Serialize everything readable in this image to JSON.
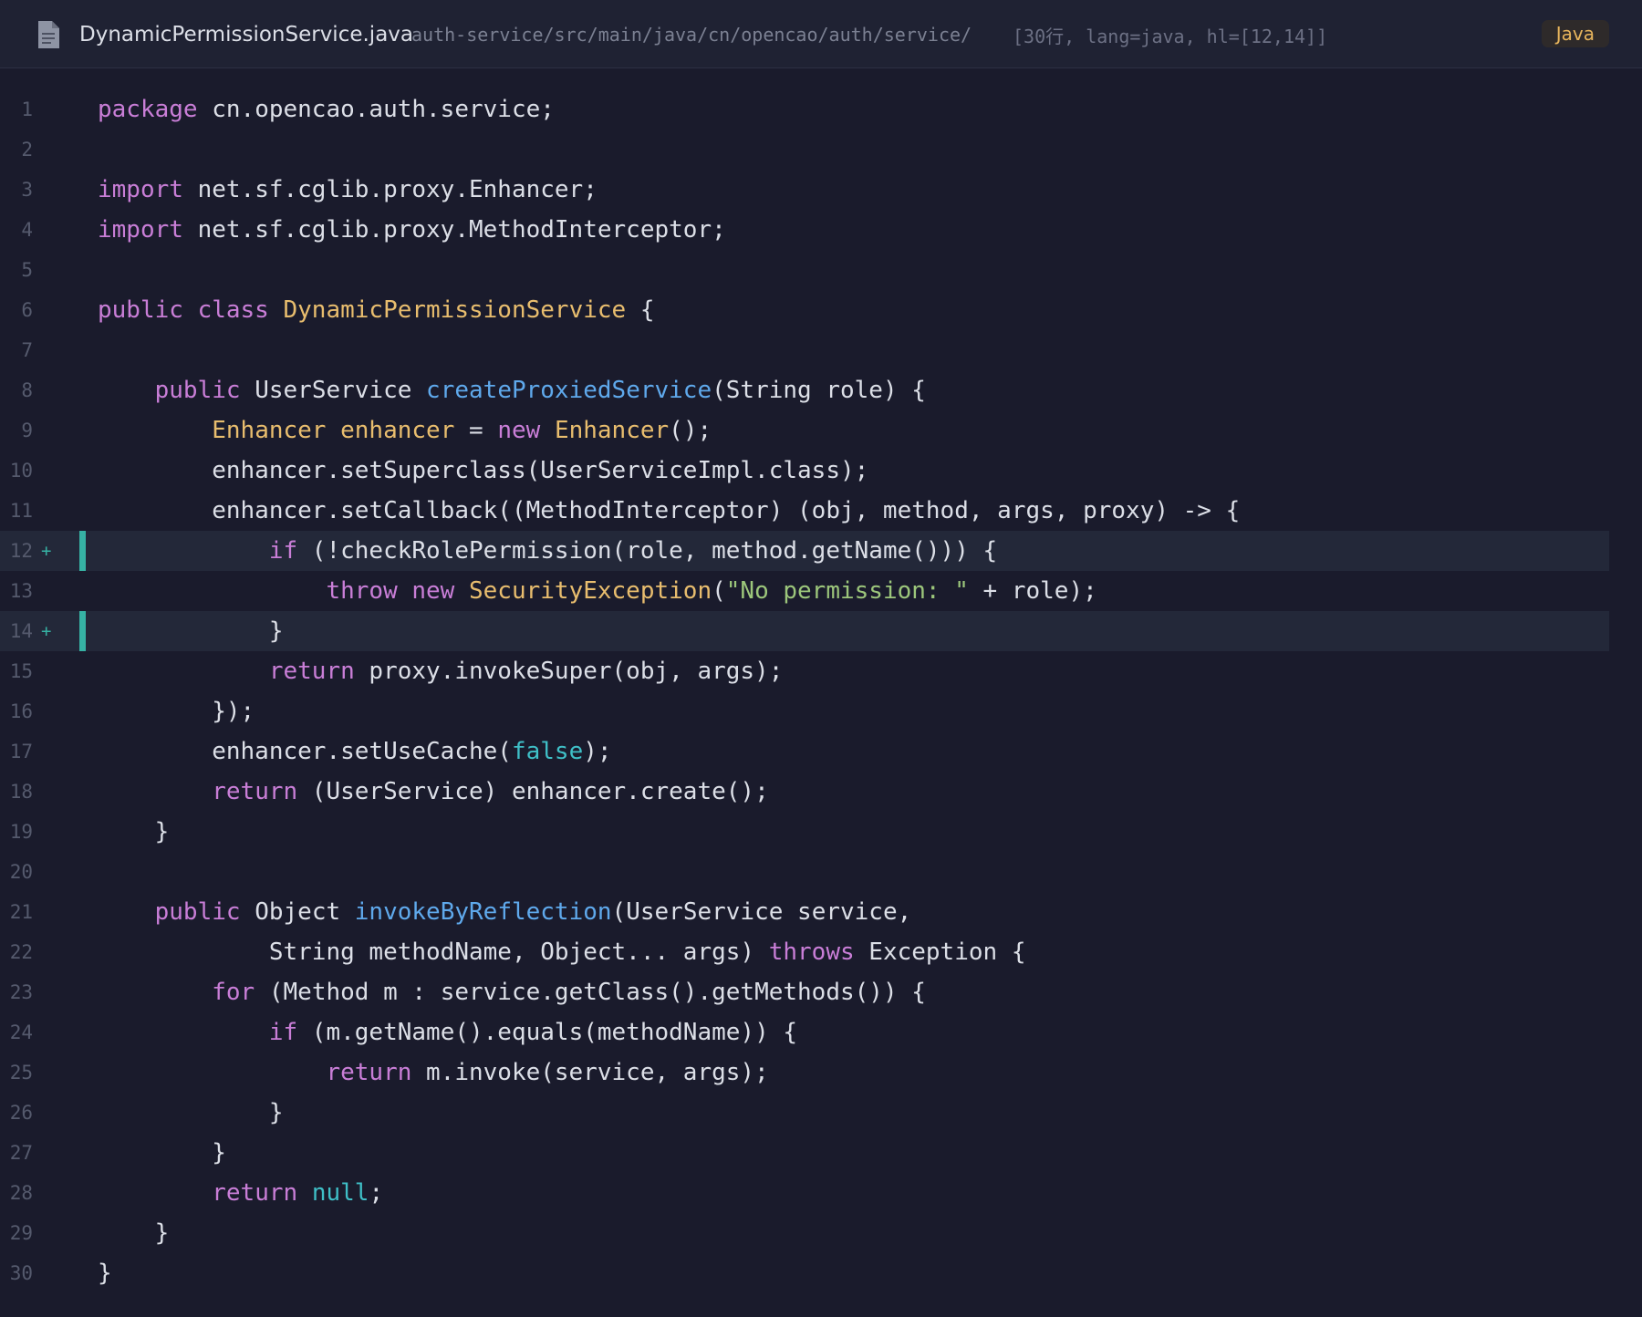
{
  "header": {
    "filename": "DynamicPermissionService.java",
    "path": "auth-service/src/main/java/cn/opencao/auth/service/",
    "meta": "[30行, lang=java, hl=[12,14]]",
    "language": "Java",
    "icon": "file-icon"
  },
  "colors": {
    "background": "#1a1b2c",
    "keyword": "#c97ed7",
    "type": "#e8bd6e",
    "function": "#5fa9ec",
    "string": "#9cc67b",
    "literal": "#3fbfc7",
    "highlight_bar": "#36b2a4"
  },
  "code": {
    "lines": [
      {
        "n": "1",
        "t": [
          [
            "kw",
            "package"
          ],
          [
            "p",
            " cn.opencao.auth.service;"
          ]
        ]
      },
      {
        "n": "2",
        "t": []
      },
      {
        "n": "3",
        "t": [
          [
            "kw",
            "import"
          ],
          [
            "p",
            " net.sf.cglib.proxy.Enhancer;"
          ]
        ]
      },
      {
        "n": "4",
        "t": [
          [
            "kw",
            "import"
          ],
          [
            "p",
            " net.sf.cglib.proxy.MethodInterceptor;"
          ]
        ]
      },
      {
        "n": "5",
        "t": []
      },
      {
        "n": "6",
        "t": [
          [
            "kw",
            "public class "
          ],
          [
            "type",
            "DynamicPermissionService"
          ],
          [
            "p",
            " {"
          ]
        ]
      },
      {
        "n": "7",
        "t": []
      },
      {
        "n": "8",
        "t": [
          [
            "p",
            "    "
          ],
          [
            "kw",
            "public"
          ],
          [
            "p",
            " UserService "
          ],
          [
            "fn",
            "createProxiedService"
          ],
          [
            "p",
            "(String role) {"
          ]
        ]
      },
      {
        "n": "9",
        "t": [
          [
            "p",
            "        "
          ],
          [
            "type",
            "Enhancer enhancer"
          ],
          [
            "p",
            " = "
          ],
          [
            "kw",
            "new "
          ],
          [
            "type",
            "Enhancer"
          ],
          [
            "p",
            "();"
          ]
        ]
      },
      {
        "n": "10",
        "t": [
          [
            "p",
            "        enhancer.setSuperclass(UserServiceImpl.class);"
          ]
        ]
      },
      {
        "n": "11",
        "t": [
          [
            "p",
            "        enhancer.setCallback((MethodInterceptor) (obj, method, args, proxy) -> {"
          ]
        ]
      },
      {
        "n": "12",
        "hl": true,
        "marker": "+",
        "t": [
          [
            "p",
            "            "
          ],
          [
            "kw",
            "if"
          ],
          [
            "p",
            " (!checkRolePermission(role, method.getName())) {"
          ]
        ]
      },
      {
        "n": "13",
        "t": [
          [
            "p",
            "                "
          ],
          [
            "kw",
            "throw new "
          ],
          [
            "type",
            "SecurityException"
          ],
          [
            "p",
            "("
          ],
          [
            "str",
            "\"No permission: \""
          ],
          [
            "p",
            " + role);"
          ]
        ]
      },
      {
        "n": "14",
        "hl": true,
        "marker": "+",
        "t": [
          [
            "p",
            "            }"
          ]
        ]
      },
      {
        "n": "15",
        "t": [
          [
            "p",
            "            "
          ],
          [
            "kw",
            "return"
          ],
          [
            "p",
            " proxy.invokeSuper(obj, args);"
          ]
        ]
      },
      {
        "n": "16",
        "t": [
          [
            "p",
            "        });"
          ]
        ]
      },
      {
        "n": "17",
        "t": [
          [
            "p",
            "        enhancer.setUseCache("
          ],
          [
            "lit",
            "false"
          ],
          [
            "p",
            ");"
          ]
        ]
      },
      {
        "n": "18",
        "t": [
          [
            "p",
            "        "
          ],
          [
            "kw",
            "return"
          ],
          [
            "p",
            " (UserService) enhancer.create();"
          ]
        ]
      },
      {
        "n": "19",
        "t": [
          [
            "p",
            "    }"
          ]
        ]
      },
      {
        "n": "20",
        "t": []
      },
      {
        "n": "21",
        "t": [
          [
            "p",
            "    "
          ],
          [
            "kw",
            "public"
          ],
          [
            "p",
            " Object "
          ],
          [
            "fn",
            "invokeByReflection"
          ],
          [
            "p",
            "(UserService service,"
          ]
        ]
      },
      {
        "n": "22",
        "t": [
          [
            "p",
            "            String methodName, Object... args) "
          ],
          [
            "kw",
            "throws"
          ],
          [
            "p",
            " Exception {"
          ]
        ]
      },
      {
        "n": "23",
        "t": [
          [
            "p",
            "        "
          ],
          [
            "kw",
            "for"
          ],
          [
            "p",
            " (Method m : service.getClass().getMethods()) {"
          ]
        ]
      },
      {
        "n": "24",
        "t": [
          [
            "p",
            "            "
          ],
          [
            "kw",
            "if"
          ],
          [
            "p",
            " (m.getName().equals(methodName)) {"
          ]
        ]
      },
      {
        "n": "25",
        "t": [
          [
            "p",
            "                "
          ],
          [
            "kw",
            "return"
          ],
          [
            "p",
            " m.invoke(service, args);"
          ]
        ]
      },
      {
        "n": "26",
        "t": [
          [
            "p",
            "            }"
          ]
        ]
      },
      {
        "n": "27",
        "t": [
          [
            "p",
            "        }"
          ]
        ]
      },
      {
        "n": "28",
        "t": [
          [
            "p",
            "        "
          ],
          [
            "kw",
            "return "
          ],
          [
            "lit",
            "null"
          ],
          [
            "p",
            ";"
          ]
        ]
      },
      {
        "n": "29",
        "t": [
          [
            "p",
            "    }"
          ]
        ]
      },
      {
        "n": "30",
        "t": [
          [
            "p",
            "}"
          ]
        ]
      }
    ]
  }
}
